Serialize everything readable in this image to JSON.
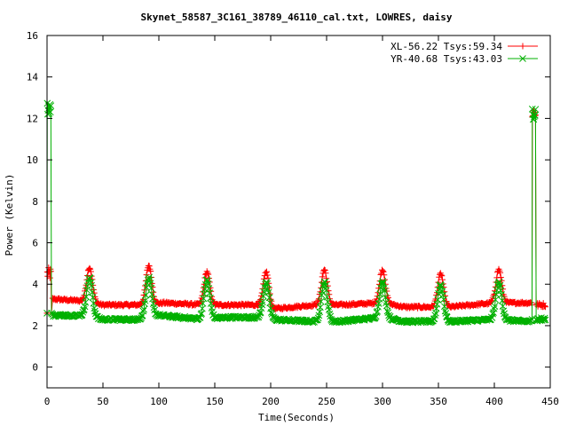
{
  "chart_data": {
    "type": "line",
    "title": "Skynet_58587_3C161_38789_46110_cal.txt, LOWRES, daisy",
    "xlabel": "Time(Seconds)",
    "ylabel": "Power (Kelvin)",
    "xlim": [
      0,
      450
    ],
    "ylim": [
      -1,
      16
    ],
    "xticks": [
      0,
      50,
      100,
      150,
      200,
      250,
      300,
      350,
      400,
      450
    ],
    "yticks": [
      0,
      2,
      4,
      6,
      8,
      10,
      12,
      14,
      16
    ],
    "legend_position": "top-right",
    "grid": false,
    "peak_times": [
      38,
      91,
      143,
      196,
      248,
      300,
      352,
      404
    ],
    "series": [
      {
        "name": "XL-56.22 Tsys:59.34",
        "color": "#ff0000",
        "marker": "+",
        "start_level": 4.5,
        "baseline": [
          [
            1,
            3.3
          ],
          [
            30,
            3.2
          ],
          [
            50,
            3.0
          ],
          [
            80,
            3.0
          ],
          [
            105,
            3.1
          ],
          [
            140,
            3.0
          ],
          [
            160,
            3.0
          ],
          [
            190,
            3.0
          ],
          [
            200,
            2.8
          ],
          [
            240,
            3.0
          ],
          [
            260,
            3.0
          ],
          [
            300,
            3.1
          ],
          [
            320,
            2.9
          ],
          [
            350,
            2.9
          ],
          [
            360,
            2.9
          ],
          [
            400,
            3.1
          ],
          [
            430,
            3.1
          ],
          [
            446,
            3.1
          ]
        ],
        "peak_height": [
          4.8,
          4.9,
          4.6,
          4.6,
          4.7,
          4.7,
          4.5,
          4.7
        ],
        "end_calibration": [
          434,
          437,
          12.3
        ],
        "end_level": 3.0
      },
      {
        "name": "YR-40.68 Tsys:43.03",
        "color": "#00b000",
        "marker": "×",
        "start_level": 12.5,
        "baseline": [
          [
            1,
            2.5
          ],
          [
            10,
            2.5
          ],
          [
            30,
            2.5
          ],
          [
            50,
            2.3
          ],
          [
            80,
            2.3
          ],
          [
            100,
            2.5
          ],
          [
            140,
            2.3
          ],
          [
            160,
            2.4
          ],
          [
            190,
            2.4
          ],
          [
            200,
            2.3
          ],
          [
            240,
            2.2
          ],
          [
            260,
            2.2
          ],
          [
            300,
            2.4
          ],
          [
            320,
            2.2
          ],
          [
            350,
            2.2
          ],
          [
            360,
            2.2
          ],
          [
            400,
            2.3
          ],
          [
            430,
            2.2
          ],
          [
            446,
            2.2
          ]
        ],
        "peak_height": [
          4.3,
          4.3,
          4.2,
          4.1,
          4.1,
          4.1,
          4.0,
          4.1
        ],
        "end_calibration": [
          434,
          437,
          12.3
        ],
        "end_level": 2.3
      }
    ]
  }
}
